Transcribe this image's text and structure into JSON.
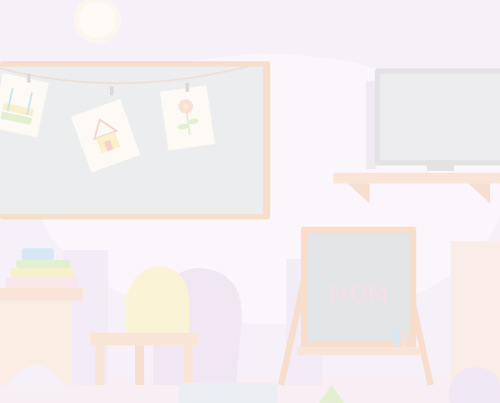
{
  "scene": {
    "easel_word": "MOM",
    "colors": {
      "wall": "#efe6f4",
      "floor": "#f1e4ea",
      "chalkboard": "#dfe0e4",
      "board_frame": "#f2c6a8",
      "wood": "#f4d2bc",
      "tv_screen": "#e1e1e3",
      "chair": "#f6eab8",
      "chair_shadow": "#e6d6ea"
    },
    "icons": [
      "lamp-icon",
      "drawing-swing-icon",
      "drawing-house-icon",
      "drawing-flower-icon",
      "tv-icon",
      "easel-icon",
      "chair-icon",
      "book-stack-icon",
      "ball-icon"
    ]
  }
}
